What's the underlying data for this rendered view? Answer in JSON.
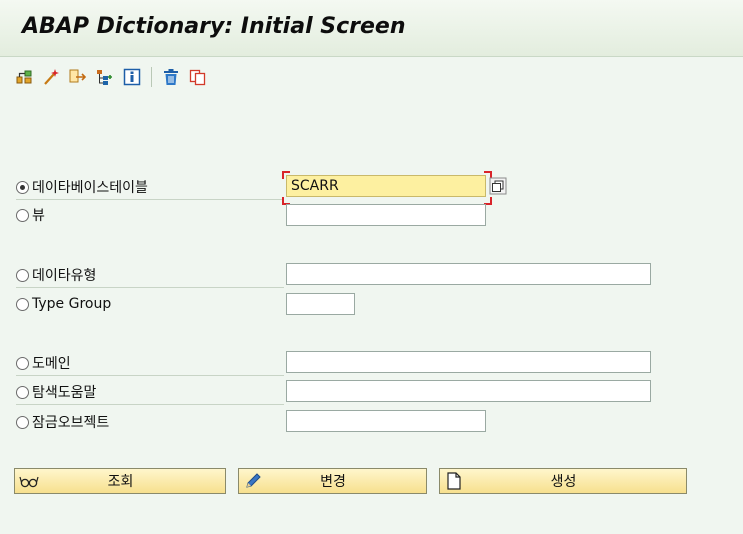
{
  "title": "ABAP Dictionary: Initial Screen",
  "toolbar": {
    "icons": [
      "object-list-icon",
      "magic-wand-icon",
      "where-used-icon",
      "hierarchy-icon",
      "info-icon",
      "delete-icon",
      "copy-icon"
    ]
  },
  "options": {
    "database_table": {
      "label": "데이타베이스테이블",
      "value": "SCARR",
      "selected": true
    },
    "view": {
      "label": "뷰",
      "value": ""
    },
    "data_type": {
      "label": "데이타유형",
      "value": ""
    },
    "type_group": {
      "label": "Type Group",
      "value": ""
    },
    "domain": {
      "label": "도메인",
      "value": ""
    },
    "search_help": {
      "label": "탐색도움말",
      "value": ""
    },
    "lock_object": {
      "label": "잠금오브젝트",
      "value": ""
    }
  },
  "buttons": {
    "display": "조회",
    "change": "변경",
    "create": "생성"
  },
  "colors": {
    "background": "#f0f6f0",
    "field_focus": "#fdf0a0",
    "button": "#f7e08e",
    "focus_corner": "#d9242a"
  }
}
